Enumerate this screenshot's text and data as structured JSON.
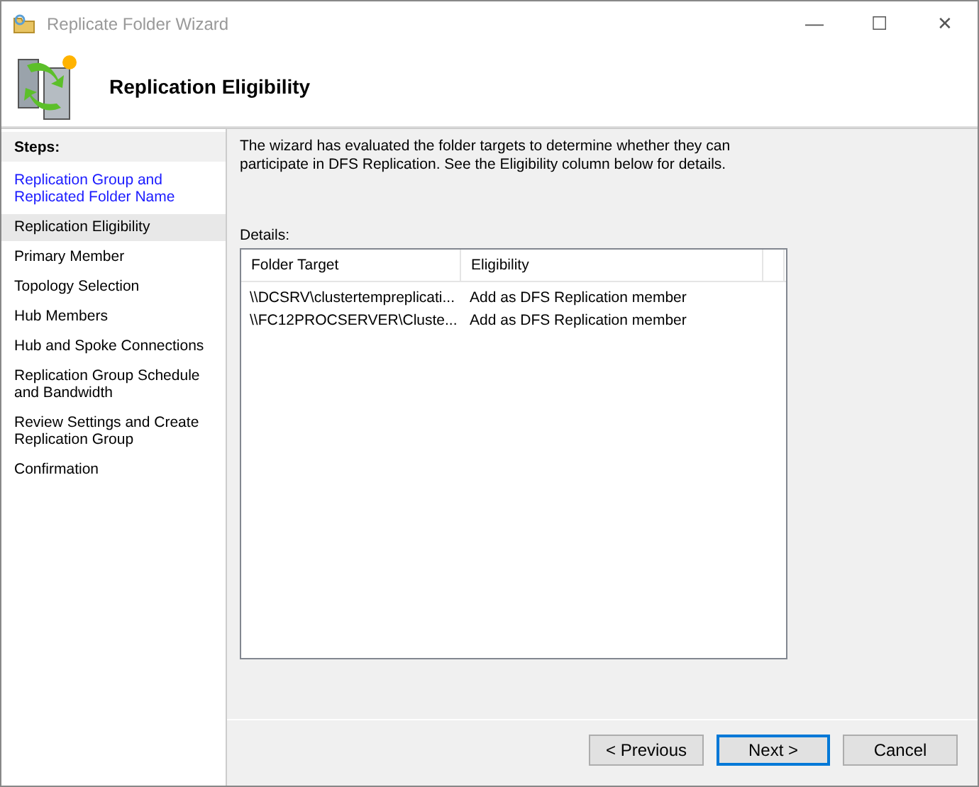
{
  "window": {
    "title": "Replicate Folder Wizard",
    "controls": [
      "—",
      "☐",
      "✕"
    ]
  },
  "header": {
    "title": "Replication Eligibility"
  },
  "steps": {
    "heading": "Steps:",
    "items": [
      {
        "label": "Replication Group and Replicated Folder Name",
        "completed": true,
        "selected": false
      },
      {
        "label": "Replication Eligibility",
        "completed": false,
        "selected": true
      },
      {
        "label": "Primary Member",
        "completed": false,
        "selected": false
      },
      {
        "label": "Topology Selection",
        "completed": false,
        "selected": false
      },
      {
        "label": "Hub Members",
        "completed": false,
        "selected": false
      },
      {
        "label": "Hub and Spoke Connections",
        "completed": false,
        "selected": false
      },
      {
        "label": "Replication Group Schedule and Bandwidth",
        "completed": false,
        "selected": false
      },
      {
        "label": "Review Settings and Create Replication Group",
        "completed": false,
        "selected": false
      },
      {
        "label": "Confirmation",
        "completed": false,
        "selected": false
      }
    ]
  },
  "description": "The wizard has evaluated the folder targets to determine whether they can participate in DFS Replication. See the Eligibility column below for details.",
  "details": {
    "label": "Details:",
    "columns": [
      "Folder Target",
      "Eligibility"
    ],
    "rows": [
      [
        "\\\\DCSRV\\clustertempreplicati...",
        "Add as DFS Replication member"
      ],
      [
        "\\\\FC12PROCSERVER\\Cluste...",
        "Add as DFS Replication member"
      ]
    ]
  },
  "buttons": [
    {
      "label": "< Previous",
      "default": false
    },
    {
      "label": "Next >",
      "default": true
    },
    {
      "label": "Cancel",
      "default": false
    }
  ]
}
